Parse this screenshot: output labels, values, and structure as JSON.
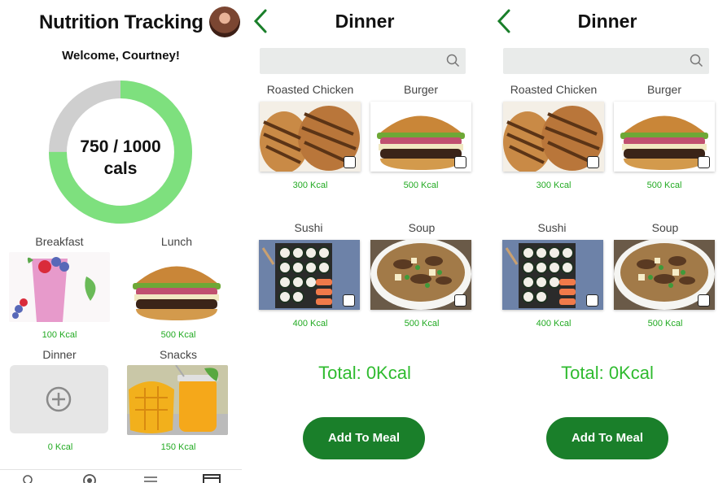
{
  "colors": {
    "accent_green": "#1a7f2a",
    "kcal_green": "#22aa22",
    "ring_green": "#7ee07e",
    "ring_gray": "#cfcfcf"
  },
  "tracking": {
    "title": "Nutrition Tracking",
    "welcome": "Welcome, Courtney!",
    "calories_consumed": 750,
    "calories_goal": 1000,
    "progress_fraction": 0.75,
    "ring_line1": "750 / 1000",
    "ring_line2": "cals",
    "meals": [
      {
        "label": "Breakfast",
        "kcal": "100 Kcal",
        "image": "smoothie"
      },
      {
        "label": "Lunch",
        "kcal": "500 Kcal",
        "image": "burger"
      },
      {
        "label": "Dinner",
        "kcal": "0 Kcal",
        "image": "add-placeholder"
      },
      {
        "label": "Snacks",
        "kcal": "150 Kcal",
        "image": "mango-juice"
      }
    ],
    "nav_icons": [
      "home-icon",
      "compass-icon",
      "menu-icon",
      "calendar-icon"
    ]
  },
  "dinner_screens": [
    {
      "title": "Dinner",
      "search_placeholder": "",
      "foods": [
        {
          "name": "Roasted Chicken",
          "kcal": "300 Kcal",
          "checked": false
        },
        {
          "name": "Burger",
          "kcal": "500 Kcal",
          "checked": false
        },
        {
          "name": "Sushi",
          "kcal": "400 Kcal",
          "checked": false
        },
        {
          "name": "Soup",
          "kcal": "500 Kcal",
          "checked": false
        }
      ],
      "total": "Total: 0Kcal",
      "add_button": "Add To Meal"
    },
    {
      "title": "Dinner",
      "search_placeholder": "",
      "foods": [
        {
          "name": "Roasted Chicken",
          "kcal": "300 Kcal",
          "checked": false
        },
        {
          "name": "Burger",
          "kcal": "500 Kcal",
          "checked": false
        },
        {
          "name": "Sushi",
          "kcal": "400 Kcal",
          "checked": false
        },
        {
          "name": "Soup",
          "kcal": "500 Kcal",
          "checked": false
        }
      ],
      "total": "Total: 0Kcal",
      "add_button": "Add To Meal"
    }
  ]
}
